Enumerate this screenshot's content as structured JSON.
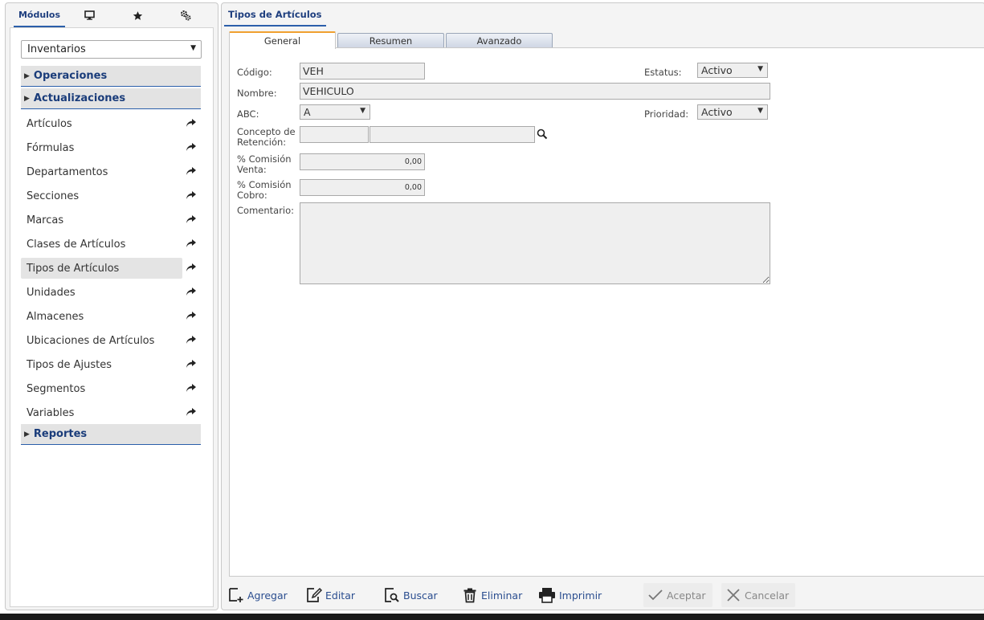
{
  "sidebar": {
    "tabs": [
      {
        "label": "Módulos",
        "icon": "modules-tab"
      },
      {
        "icon": "monitor-icon"
      },
      {
        "icon": "star-icon"
      },
      {
        "icon": "settings-gear-icon"
      }
    ],
    "module_select": {
      "value": "Inventarios"
    },
    "sections": {
      "operaciones": "Operaciones",
      "actualizaciones": "Actualizaciones",
      "reportes": "Reportes"
    },
    "items": [
      {
        "label": "Artículos"
      },
      {
        "label": "Fórmulas"
      },
      {
        "label": "Departamentos"
      },
      {
        "label": "Secciones"
      },
      {
        "label": "Marcas"
      },
      {
        "label": "Clases de Artículos"
      },
      {
        "label": "Tipos de Artículos",
        "active": true
      },
      {
        "label": "Unidades"
      },
      {
        "label": "Almacenes"
      },
      {
        "label": "Ubicaciones de Artículos"
      },
      {
        "label": "Tipos de Ajustes"
      },
      {
        "label": "Segmentos"
      },
      {
        "label": "Variables"
      }
    ]
  },
  "main": {
    "title": "Tipos de Artículos",
    "tabs": [
      {
        "label": "General",
        "active": true
      },
      {
        "label": "Resumen"
      },
      {
        "label": "Avanzado"
      }
    ],
    "form": {
      "codigo": {
        "label": "Código:",
        "value": "VEH"
      },
      "estatus": {
        "label": "Estatus:",
        "value": "Activo"
      },
      "nombre": {
        "label": "Nombre:",
        "value": "VEHICULO"
      },
      "abc": {
        "label": "ABC:",
        "value": "A"
      },
      "prioridad": {
        "label": "Prioridad:",
        "value": "Activo"
      },
      "concepto": {
        "label_line1": "Concepto de",
        "label_line2": "Retención:",
        "code": "",
        "description": ""
      },
      "comision_venta": {
        "label_line1": "% Comisión",
        "label_line2": "Venta:",
        "value": "0,00"
      },
      "comision_cobro": {
        "label_line1": "% Comisión",
        "label_line2": "Cobro:",
        "value": "0,00"
      },
      "comentario": {
        "label": "Comentario:",
        "value": ""
      }
    }
  },
  "toolbar": {
    "agregar": "Agregar",
    "editar": "Editar",
    "buscar": "Buscar",
    "eliminar": "Eliminar",
    "imprimir": "Imprimir",
    "aceptar": "Aceptar",
    "cancelar": "Cancelar"
  },
  "colors": {
    "accent": "#2b5faa",
    "title_text": "#1f3f7f",
    "tab_active_top": "#f0a030"
  }
}
